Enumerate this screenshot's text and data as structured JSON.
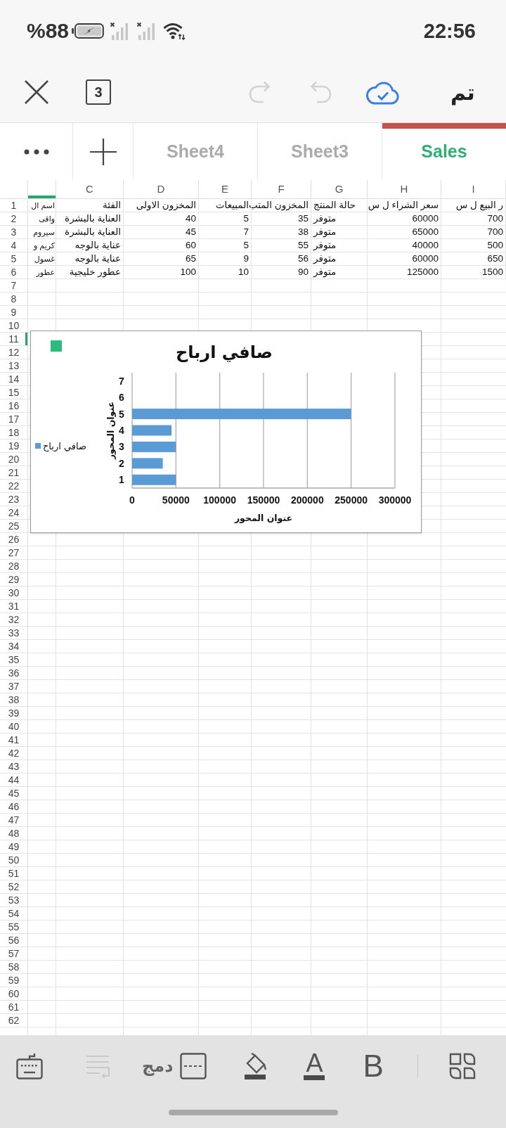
{
  "status_bar": {
    "battery_text": "%88",
    "charging": true,
    "time": "22:56"
  },
  "toolbar": {
    "sheet_count": "3",
    "redo": {
      "disabled": true
    },
    "undo": {
      "disabled": true
    },
    "cloud_synced": true,
    "done_label": "تم"
  },
  "sheet_tabs": [
    {
      "label": "Sales",
      "selected": true
    },
    {
      "label": "Sheet3",
      "selected": false
    },
    {
      "label": "Sheet4",
      "selected": false
    }
  ],
  "sheet": {
    "columns": [
      {
        "label": "I",
        "selected": false
      },
      {
        "label": "H",
        "selected": false
      },
      {
        "label": "G",
        "selected": false
      },
      {
        "label": "F",
        "selected": false
      },
      {
        "label": "E",
        "selected": false
      },
      {
        "label": "D",
        "selected": false
      },
      {
        "label": "C",
        "selected": false
      },
      {
        "selected": true
      }
    ],
    "rows": [
      {
        "number": "1",
        "selected": false,
        "cells": [
          "ر البيع ل س",
          "سعر الشراء ل س",
          "حالة المنتج",
          "المخزون المتب",
          "المبيعات",
          "المخزون الاولى",
          "الفئة",
          "اسم ال"
        ]
      },
      {
        "number": "2",
        "selected": false,
        "cells": [
          "700",
          "60000",
          "متوفر",
          "35",
          "5",
          "40",
          "العناية بالبشرة",
          "واقى"
        ]
      },
      {
        "number": "3",
        "selected": false,
        "cells": [
          "700",
          "65000",
          "متوفر",
          "38",
          "7",
          "45",
          "العناية بالبشرة",
          "سيروم"
        ]
      },
      {
        "number": "4",
        "selected": false,
        "cells": [
          "500",
          "40000",
          "متوفر",
          "55",
          "5",
          "60",
          "عناية بالوجه",
          "كريم و"
        ]
      },
      {
        "number": "5",
        "selected": false,
        "cells": [
          "650",
          "60000",
          "متوفر",
          "56",
          "9",
          "65",
          "عناية بالوجه",
          "غسول"
        ]
      },
      {
        "number": "6",
        "selected": false,
        "cells": [
          "1500",
          "125000",
          "متوفر",
          "90",
          "10",
          "100",
          "عطور خليجية",
          "عطور"
        ]
      },
      {
        "number": "7",
        "selected": false
      },
      {
        "number": "8",
        "selected": false
      },
      {
        "number": "9",
        "selected": false
      },
      {
        "number": "10",
        "selected": false
      },
      {
        "number": "11",
        "selected": true
      },
      {
        "number": "12",
        "selected": false
      },
      {
        "number": "13",
        "selected": false
      },
      {
        "number": "14",
        "selected": false
      },
      {
        "number": "15",
        "selected": false
      },
      {
        "number": "16",
        "selected": false
      },
      {
        "number": "17",
        "selected": false
      },
      {
        "number": "18",
        "selected": false
      },
      {
        "number": "19",
        "selected": false
      },
      {
        "number": "20",
        "selected": false
      },
      {
        "number": "21",
        "selected": false
      },
      {
        "number": "22",
        "selected": false
      },
      {
        "number": "23",
        "selected": false
      },
      {
        "number": "24",
        "selected": false
      },
      {
        "number": "25",
        "selected": false
      },
      {
        "number": "26",
        "selected": false
      },
      {
        "number": "27",
        "selected": false
      },
      {
        "number": "28",
        "selected": false
      },
      {
        "number": "29",
        "selected": false
      },
      {
        "number": "30",
        "selected": false
      },
      {
        "number": "31",
        "selected": false
      },
      {
        "number": "32",
        "selected": false
      },
      {
        "number": "33",
        "selected": false
      },
      {
        "number": "34",
        "selected": false
      },
      {
        "number": "35",
        "selected": false
      },
      {
        "number": "36",
        "selected": false
      },
      {
        "number": "37",
        "selected": false
      },
      {
        "number": "38",
        "selected": false
      },
      {
        "number": "39",
        "selected": false
      },
      {
        "number": "40",
        "selected": false
      },
      {
        "number": "41",
        "selected": false
      },
      {
        "number": "42",
        "selected": false
      },
      {
        "number": "43",
        "selected": false
      },
      {
        "number": "44",
        "selected": false
      },
      {
        "number": "45",
        "selected": false
      },
      {
        "number": "46",
        "selected": false
      },
      {
        "number": "47",
        "selected": false
      },
      {
        "number": "48",
        "selected": false
      },
      {
        "number": "49",
        "selected": false
      },
      {
        "number": "50",
        "selected": false
      },
      {
        "number": "51",
        "selected": false
      },
      {
        "number": "52",
        "selected": false
      },
      {
        "number": "53",
        "selected": false
      },
      {
        "number": "54",
        "selected": false
      },
      {
        "number": "55",
        "selected": false
      },
      {
        "number": "56",
        "selected": false
      },
      {
        "number": "57",
        "selected": false
      },
      {
        "number": "58",
        "selected": false
      },
      {
        "number": "59",
        "selected": false
      },
      {
        "number": "60",
        "selected": false
      },
      {
        "number": "61",
        "selected": false
      },
      {
        "number": "62",
        "selected": false
      }
    ],
    "chart": {
      "chart_data": {
        "type": "bar",
        "orientation": "horizontal",
        "title": "صافي ارباح",
        "xlabel": "عنوان المحور",
        "ylabel": "عنوان المحور",
        "categories": [
          "7",
          "6",
          "5",
          "4",
          "3",
          "2",
          "1"
        ],
        "series": [
          {
            "name": "صافي ارباح",
            "color": "#5b9bd5",
            "values": [
              null,
              null,
              250000,
              45000,
              50000,
              35000,
              50000
            ]
          }
        ],
        "xlim": [
          0,
          300000
        ],
        "xticks": [
          0,
          50000,
          100000,
          150000,
          200000,
          250000,
          300000
        ],
        "grid": true
      }
    }
  },
  "format_bar": {
    "wrap_text": {
      "disabled": true
    },
    "merge_label": "دمج",
    "font_color_glyph": "A",
    "bold_glyph": "B"
  }
}
